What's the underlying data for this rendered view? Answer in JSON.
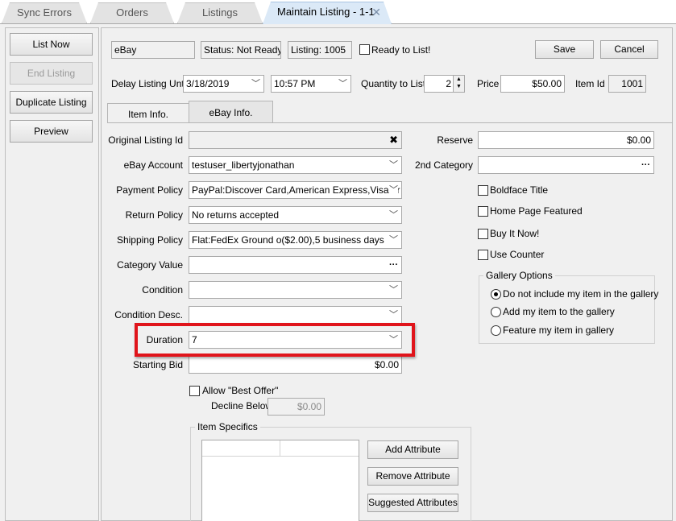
{
  "tabs": [
    "Sync Errors",
    "Orders",
    "Listings",
    "Maintain Listing - 1-1"
  ],
  "tab_close": "✕",
  "left_buttons": {
    "list_now": "List Now",
    "end_listing": "End Listing",
    "duplicate": "Duplicate Listing",
    "preview": "Preview"
  },
  "header": {
    "channel": "eBay",
    "status": "Status: Not Ready",
    "listing": "Listing: 1005",
    "ready_label": "Ready to List!",
    "save": "Save",
    "cancel": "Cancel"
  },
  "row2": {
    "delay_label": "Delay Listing Until",
    "date": "3/18/2019",
    "time": "10:57 PM",
    "qty_label": "Quantity to List",
    "qty": "2",
    "price_label": "Price",
    "price": "$50.00",
    "itemid_label": "Item Id",
    "itemid": "1001"
  },
  "inner_tabs": [
    "Item Info.",
    "eBay Info."
  ],
  "form": {
    "original_listing_id": {
      "label": "Original Listing Id",
      "value": ""
    },
    "ebay_account": {
      "label": "eBay Account",
      "value": "testuser_libertyjonathan"
    },
    "payment_policy": {
      "label": "Payment Policy",
      "value": "PayPal:Discover Card,American Express,Visa or"
    },
    "return_policy": {
      "label": "Return Policy",
      "value": "No returns accepted"
    },
    "shipping_policy": {
      "label": "Shipping Policy",
      "value": "Flat:FedEx Ground o($2.00),5 business days"
    },
    "category_value": {
      "label": "Category Value",
      "value": ""
    },
    "condition": {
      "label": "Condition",
      "value": ""
    },
    "condition_desc": {
      "label": "Condition Desc.",
      "value": ""
    },
    "duration": {
      "label": "Duration",
      "value": "7"
    },
    "starting_bid": {
      "label": "Starting Bid",
      "value": "$0.00"
    },
    "best_offer_label": "Allow \"Best Offer\"",
    "decline_label": "Decline Below",
    "decline_value": "$0.00"
  },
  "right": {
    "reserve_label": "Reserve",
    "reserve": "$0.00",
    "second_cat_label": "2nd Category",
    "second_cat": "",
    "boldface": "Boldface Title",
    "home_featured": "Home Page Featured",
    "buy_it_now": "Buy It Now!",
    "use_counter": "Use Counter",
    "gallery_title": "Gallery Options",
    "gallery_opts": [
      "Do not include my item in the gallery",
      "Add my item to the gallery",
      "Feature my item in gallery"
    ]
  },
  "specifics": {
    "title": "Item Specifics",
    "add": "Add Attribute",
    "remove": "Remove Attribute",
    "suggested": "Suggested Attributes"
  },
  "icons": {
    "clear": "clear-x-icon",
    "ellipsis": "ellipsis-icon",
    "dropdown": "chevron-down-icon"
  },
  "colors": {
    "highlight": "#e0141b",
    "active_tab": "#dbe9f7"
  }
}
